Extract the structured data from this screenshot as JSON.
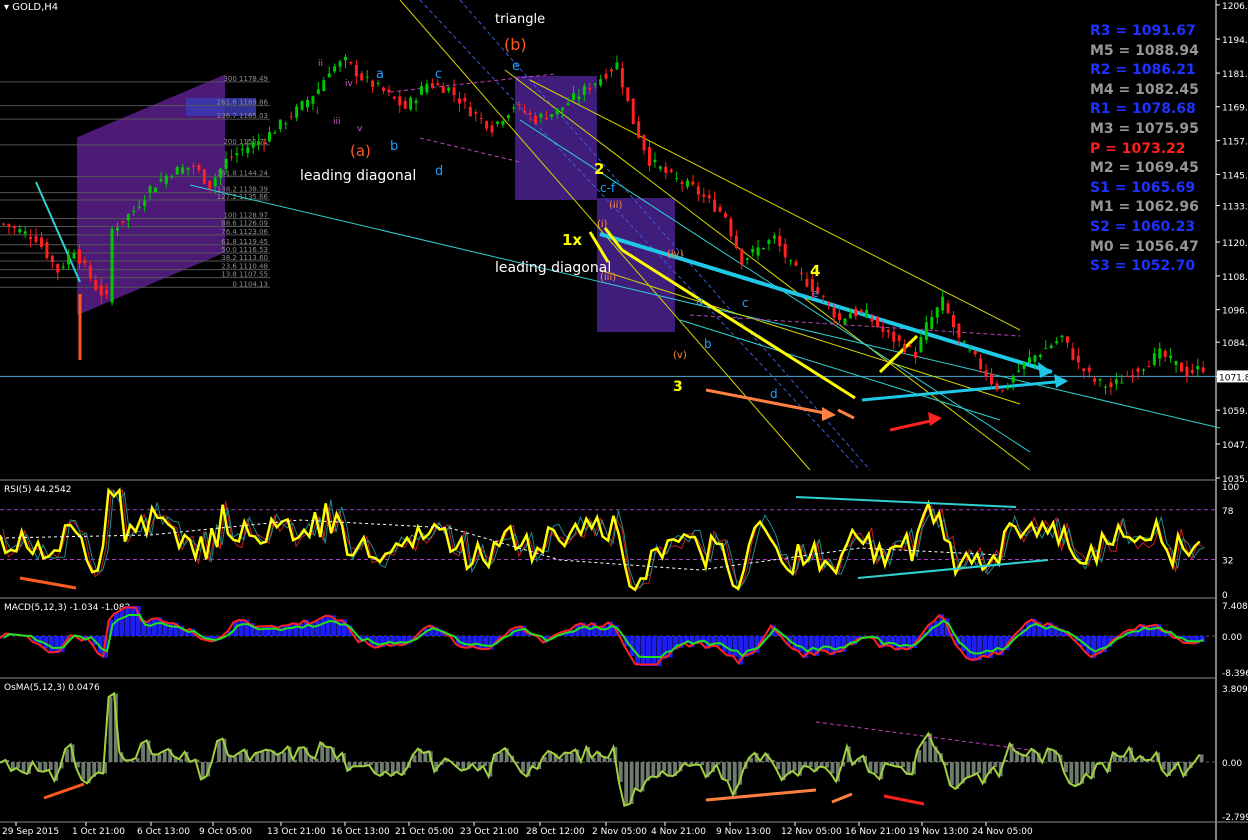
{
  "symbol_label": "GOLD,H4",
  "colors": {
    "bull": "#00c800",
    "bear": "#ff2020",
    "bg": "#000000",
    "axis": "#ffffff",
    "grid": "#3a3a3a"
  },
  "chart_data": [
    {
      "type": "candlestick",
      "title": "GOLD,H4",
      "ylim": [
        1035,
        1206
      ],
      "y_ticks": [
        "1206.4",
        "1194.0",
        "1181.7",
        "1169.5",
        "1157.2",
        "1145.0",
        "1133.7",
        "1120.5",
        "1108.2",
        "1096.0",
        "1084.2",
        "1071.8",
        "1059.6",
        "1047.3",
        "1035.0"
      ],
      "x_ticks": [
        "29 Sep 2015",
        "1 Oct 21:00",
        "6 Oct 13:00",
        "9 Oct 05:00",
        "13 Oct 21:00",
        "16 Oct 13:00",
        "21 Oct 05:00",
        "23 Oct 21:00",
        "28 Oct 12:00",
        "2 Nov 05:00",
        "4 Nov 21:00",
        "9 Nov 13:00",
        "12 Nov 05:00",
        "16 Nov 21:00",
        "19 Nov 13:00",
        "24 Nov 05:00"
      ],
      "current_price": "1071.8",
      "close_path": [
        [
          0,
          1127
        ],
        [
          6,
          1122
        ],
        [
          10,
          1110
        ],
        [
          13,
          1118
        ],
        [
          17,
          1104
        ],
        [
          19,
          1100
        ],
        [
          20,
          1125
        ],
        [
          24,
          1132
        ],
        [
          27,
          1140
        ],
        [
          31,
          1146
        ],
        [
          35,
          1148
        ],
        [
          38,
          1141
        ],
        [
          41,
          1150
        ],
        [
          44,
          1154
        ],
        [
          48,
          1158
        ],
        [
          51,
          1163
        ],
        [
          55,
          1170
        ],
        [
          58,
          1176
        ],
        [
          60,
          1183
        ],
        [
          63,
          1186
        ],
        [
          66,
          1180
        ],
        [
          70,
          1175
        ],
        [
          74,
          1169
        ],
        [
          78,
          1178
        ],
        [
          82,
          1176
        ],
        [
          86,
          1168
        ],
        [
          90,
          1162
        ],
        [
          94,
          1170
        ],
        [
          98,
          1165
        ],
        [
          102,
          1168
        ],
        [
          106,
          1174
        ],
        [
          110,
          1180
        ],
        [
          113,
          1185
        ],
        [
          116,
          1164
        ],
        [
          119,
          1150
        ],
        [
          123,
          1144
        ],
        [
          127,
          1140
        ],
        [
          130,
          1135
        ],
        [
          133,
          1130
        ],
        [
          134,
          1124
        ],
        [
          136,
          1114
        ],
        [
          139,
          1118
        ],
        [
          142,
          1122
        ],
        [
          145,
          1112
        ],
        [
          148,
          1106
        ],
        [
          151,
          1100
        ],
        [
          154,
          1092
        ],
        [
          156,
          1095
        ],
        [
          159,
          1094
        ],
        [
          162,
          1088
        ],
        [
          165,
          1084
        ],
        [
          168,
          1080
        ],
        [
          170,
          1090
        ],
        [
          173,
          1099
        ],
        [
          176,
          1085
        ],
        [
          179,
          1078
        ],
        [
          182,
          1070
        ],
        [
          184,
          1066
        ],
        [
          186,
          1072
        ],
        [
          189,
          1078
        ],
        [
          192,
          1082
        ],
        [
          195,
          1086
        ],
        [
          198,
          1076
        ],
        [
          201,
          1070
        ],
        [
          204,
          1068
        ],
        [
          207,
          1072
        ],
        [
          210,
          1076
        ],
        [
          213,
          1080
        ],
        [
          216,
          1076
        ],
        [
          218,
          1073
        ],
        [
          221,
          1075
        ]
      ],
      "fib_levels": [
        {
          "label": "300 1178.49",
          "value": 1178.5
        },
        {
          "label": "261.8 1169.86",
          "value": 1169.9
        },
        {
          "label": "236.7 1165.03",
          "value": 1165.0
        },
        {
          "label": "200 1155.71",
          "value": 1155.7
        },
        {
          "label": "161.8 1144.24",
          "value": 1144.2
        },
        {
          "label": "138.2 1138.39",
          "value": 1138.4
        },
        {
          "label": "127.2 1135.66",
          "value": 1135.7
        },
        {
          "label": "100 1128.97",
          "value": 1129.0
        },
        {
          "label": "88.6 1126.09",
          "value": 1126.1
        },
        {
          "label": "76.4 1123.06",
          "value": 1123.1
        },
        {
          "label": "61.8 1119.45",
          "value": 1119.5
        },
        {
          "label": "50.0 1116.53",
          "value": 1116.5
        },
        {
          "label": "38.2 1113.60",
          "value": 1113.6
        },
        {
          "label": "23.6 1110.48",
          "value": 1110.5
        },
        {
          "label": "13.8 1107.55",
          "value": 1107.6
        },
        {
          "label": "0 1104.13",
          "value": 1104.1
        }
      ],
      "annotations": [
        {
          "text": "triangle",
          "color": "#ffffff"
        },
        {
          "text": "(b)",
          "color": "#ff5a1e"
        },
        {
          "text": "e",
          "color": "#1ea0ff"
        },
        {
          "text": "a",
          "color": "#1ea0ff"
        },
        {
          "text": "c",
          "color": "#1ea0ff"
        },
        {
          "text": "b",
          "color": "#1ea0ff"
        },
        {
          "text": "d",
          "color": "#1ea0ff"
        },
        {
          "text": "(a)",
          "color": "#ff5a1e"
        },
        {
          "text": "leading diagonal",
          "color": "#ffffff"
        },
        {
          "text": "leading diagonal",
          "color": "#ffffff"
        },
        {
          "text": "2",
          "color": "#ffff00"
        },
        {
          "text": "1x",
          "color": "#ffff00"
        },
        {
          "text": "c-f",
          "color": "#1ea0ff"
        },
        {
          "text": "3",
          "color": "#ffff00"
        },
        {
          "text": "4",
          "color": "#ffff00"
        },
        {
          "text": "e",
          "color": "#1ea0ff"
        },
        {
          "text": "a",
          "color": "#1ea0ff"
        },
        {
          "text": "b",
          "color": "#1ea0ff"
        },
        {
          "text": "c",
          "color": "#1ea0ff"
        },
        {
          "text": "d",
          "color": "#1ea0ff"
        },
        {
          "text": "(v)",
          "color": "#ff8c40"
        },
        {
          "text": "(iii)",
          "color": "#ff8c40"
        },
        {
          "text": "(ii)",
          "color": "#ff8c40"
        },
        {
          "text": "(i)",
          "color": "#ff8c40"
        },
        {
          "text": "(iv)",
          "color": "#ff8c40"
        },
        {
          "text": "i",
          "color": "#c060c0"
        },
        {
          "text": "ii",
          "color": "#c060c0"
        },
        {
          "text": "iii",
          "color": "#c060c0"
        },
        {
          "text": "iv",
          "color": "#c060c0"
        },
        {
          "text": "v",
          "color": "#c060c0"
        }
      ]
    },
    {
      "type": "line",
      "title": "RSI(5) 44.2542",
      "ylim": [
        0,
        100
      ],
      "y_ticks": [
        "100",
        "78",
        "32",
        "0"
      ],
      "levels": [
        78,
        32
      ]
    },
    {
      "type": "bar",
      "title": "MACD(5,12,3) -1.034 -1.082",
      "y_ticks": [
        "7.408",
        "0.00",
        "-8.396"
      ]
    },
    {
      "type": "bar",
      "title": "OsMA(5,12,3) 0.0476",
      "y_ticks": [
        "3.809",
        "0.00",
        "-2.799"
      ]
    }
  ],
  "pivots": [
    {
      "text": "R3 = 1091.67",
      "color": "#1e32ff"
    },
    {
      "text": "M5 = 1088.94",
      "color": "#969696"
    },
    {
      "text": "R2 = 1086.21",
      "color": "#1e32ff"
    },
    {
      "text": "M4 = 1082.45",
      "color": "#969696"
    },
    {
      "text": "R1 = 1078.68",
      "color": "#1e32ff"
    },
    {
      "text": "M3 = 1075.95",
      "color": "#969696"
    },
    {
      "text": "P   = 1073.22",
      "color": "#ff1e1e"
    },
    {
      "text": "M2 = 1069.45",
      "color": "#969696"
    },
    {
      "text": "S1 = 1065.69",
      "color": "#1e32ff"
    },
    {
      "text": "M1 = 1062.96",
      "color": "#969696"
    },
    {
      "text": "S2 = 1060.23",
      "color": "#1e32ff"
    },
    {
      "text": "M0 = 1056.47",
      "color": "#969696"
    },
    {
      "text": "S3 = 1052.70",
      "color": "#1e32ff"
    }
  ]
}
